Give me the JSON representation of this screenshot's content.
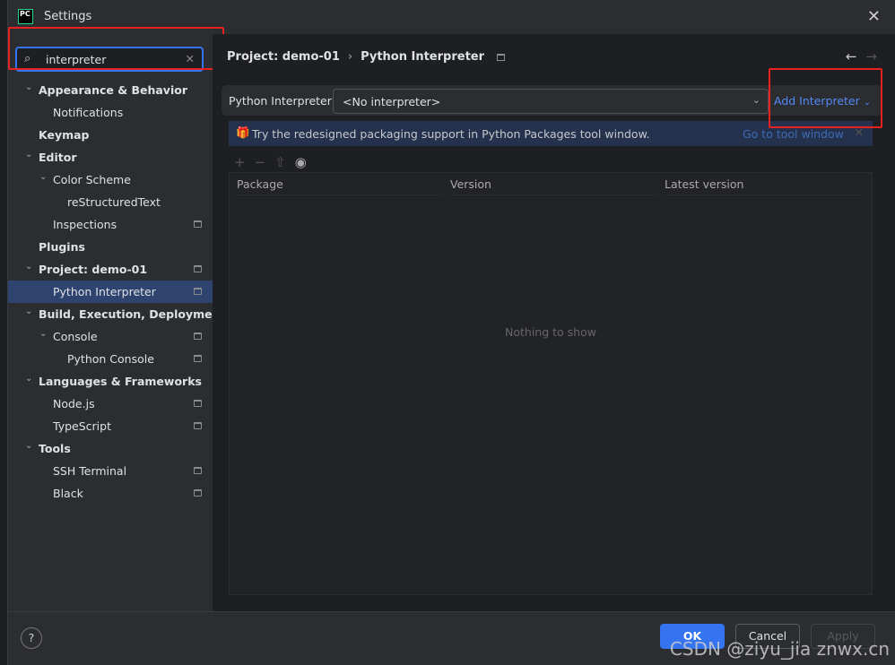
{
  "window": {
    "title": "Settings",
    "logo": "PC"
  },
  "search": {
    "value": "interpreter"
  },
  "tree": [
    {
      "label": "Appearance & Behavior",
      "level": 0,
      "bold": true,
      "arrow": true
    },
    {
      "label": "Notifications",
      "level": 1
    },
    {
      "label": "Keymap",
      "level": 0,
      "bold": true
    },
    {
      "label": "Editor",
      "level": 0,
      "bold": true,
      "arrow": true
    },
    {
      "label": "Color Scheme",
      "level": 1,
      "arrow": true
    },
    {
      "label": "reStructuredText",
      "level": 2
    },
    {
      "label": "Inspections",
      "level": 1,
      "pin": true
    },
    {
      "label": "Plugins",
      "level": 0,
      "bold": true
    },
    {
      "label": "Project: demo-01",
      "level": 0,
      "bold": true,
      "arrow": true,
      "pin": true
    },
    {
      "label": "Python Interpreter",
      "level": 1,
      "pin": true,
      "selected": true
    },
    {
      "label": "Build, Execution, Deployment",
      "level": 0,
      "bold": true,
      "arrow": true
    },
    {
      "label": "Console",
      "level": 1,
      "arrow": true,
      "pin": true
    },
    {
      "label": "Python Console",
      "level": 2,
      "pin": true
    },
    {
      "label": "Languages & Frameworks",
      "level": 0,
      "bold": true,
      "arrow": true
    },
    {
      "label": "Node.js",
      "level": 1,
      "pin": true
    },
    {
      "label": "TypeScript",
      "level": 1,
      "pin": true
    },
    {
      "label": "Tools",
      "level": 0,
      "bold": true,
      "arrow": true
    },
    {
      "label": "SSH Terminal",
      "level": 1,
      "pin": true
    },
    {
      "label": "Black",
      "level": 1,
      "pin": true
    }
  ],
  "breadcrumb": {
    "parent": "Project: demo-01",
    "sep": "›",
    "current": "Python Interpreter"
  },
  "interpreter": {
    "label": "Python Interpreter:",
    "value": "<No interpreter>",
    "add": "Add Interpreter"
  },
  "banner": {
    "text": "Try the redesigned packaging support in Python Packages tool window.",
    "link": "Go to tool window"
  },
  "table": {
    "columns": [
      "Package",
      "Version",
      "Latest version"
    ],
    "empty": "Nothing to show"
  },
  "footer": {
    "help": "?",
    "ok": "OK",
    "cancel": "Cancel",
    "apply": "Apply"
  },
  "watermark": "CSDN @ziyu_jia znwx.cn",
  "colors": {
    "accent": "#3574f0",
    "highlight": "#e8231f"
  }
}
